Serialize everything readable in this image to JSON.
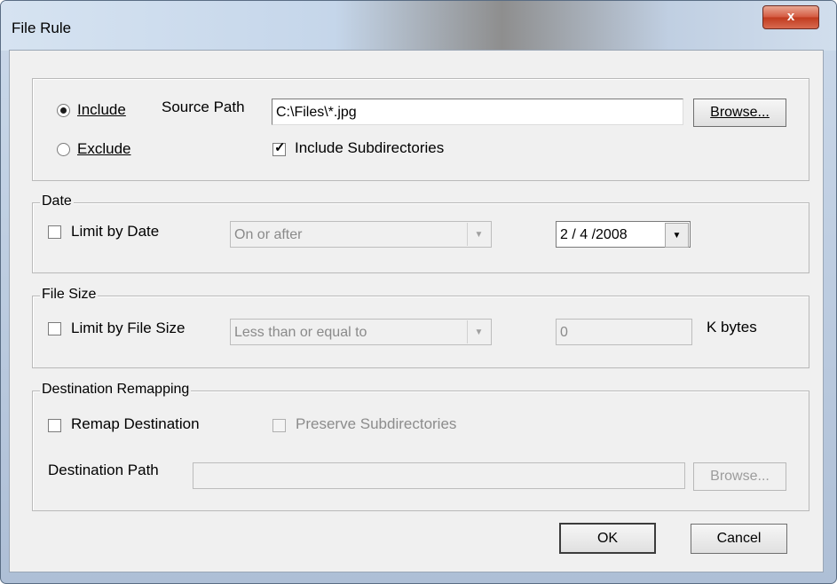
{
  "window": {
    "title": "File Rule",
    "close_glyph": "x"
  },
  "source": {
    "include_label": "Include",
    "exclude_label": "Exclude",
    "source_path_label": "Source Path",
    "source_path_value": "C:\\Files\\*.jpg",
    "browse_label": "Browse...",
    "include_subdirs_label": "Include Subdirectories",
    "include_selected": true,
    "include_subdirs_checked": true
  },
  "date": {
    "legend": "Date",
    "limit_label": "Limit by Date",
    "condition_value": "On or after",
    "date_value": "2 / 4 /2008",
    "limit_checked": false
  },
  "filesize": {
    "legend": "File Size",
    "limit_label": "Limit by File Size",
    "condition_value": "Less than or equal to",
    "size_value": "0",
    "unit_label": "K bytes",
    "limit_checked": false
  },
  "remap": {
    "legend": "Destination Remapping",
    "remap_label": "Remap Destination",
    "preserve_label": "Preserve Subdirectories",
    "dest_path_label": "Destination Path",
    "dest_path_value": "",
    "browse_label": "Browse...",
    "remap_checked": false,
    "preserve_checked": false
  },
  "buttons": {
    "ok_label": "OK",
    "cancel_label": "Cancel"
  },
  "icons": {
    "dropdown": "chevron-down-icon",
    "close": "close-icon",
    "check": "checkmark-icon"
  }
}
